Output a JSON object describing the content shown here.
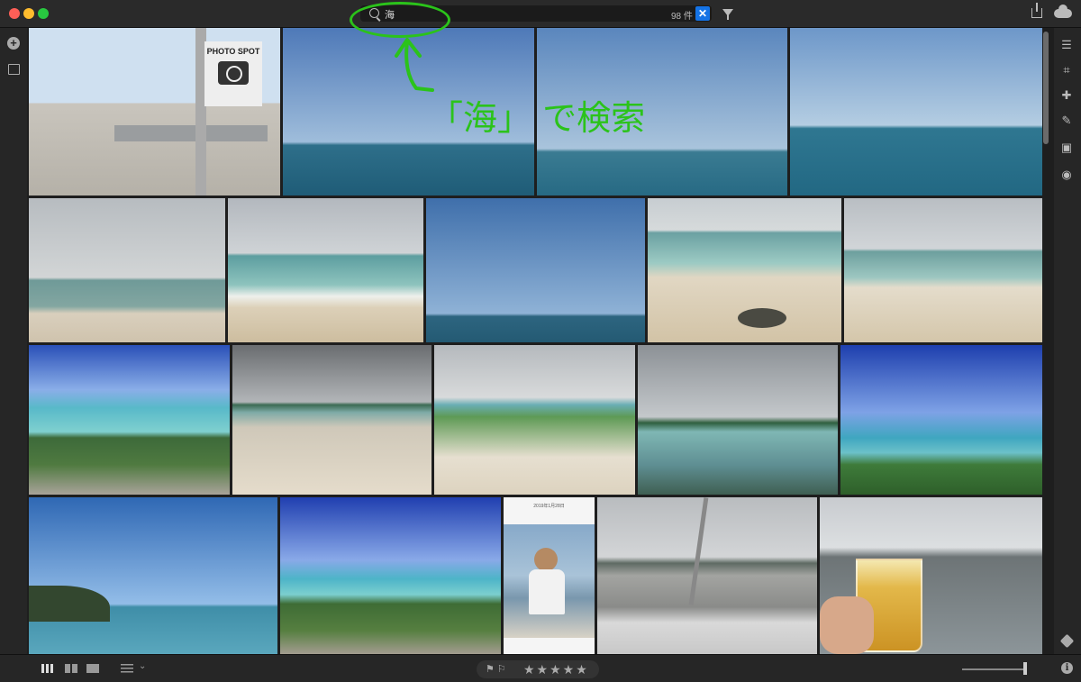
{
  "window": {
    "search_query": "海",
    "result_count": "98 件",
    "clear_label": "✕"
  },
  "annotation": {
    "text": "「海」 で検索"
  },
  "photos": {
    "photo_spot_sign": "PHOTO SPOT",
    "phone_date": "2019年1月28日"
  },
  "bottom_bar": {
    "stars": "★★★★★",
    "flags": "⚑ ⚐"
  },
  "colors": {
    "accent": "#1473e6",
    "annotation": "#2bc31a",
    "background": "#1e1e1e"
  },
  "icons": [
    "search-icon",
    "filter-icon",
    "share-icon",
    "cloud-icon",
    "add-icon",
    "library-icon",
    "sliders-icon",
    "crop-icon",
    "healing-icon",
    "brush-icon",
    "gradient-icon",
    "radial-icon",
    "tag-icon",
    "info-icon"
  ]
}
